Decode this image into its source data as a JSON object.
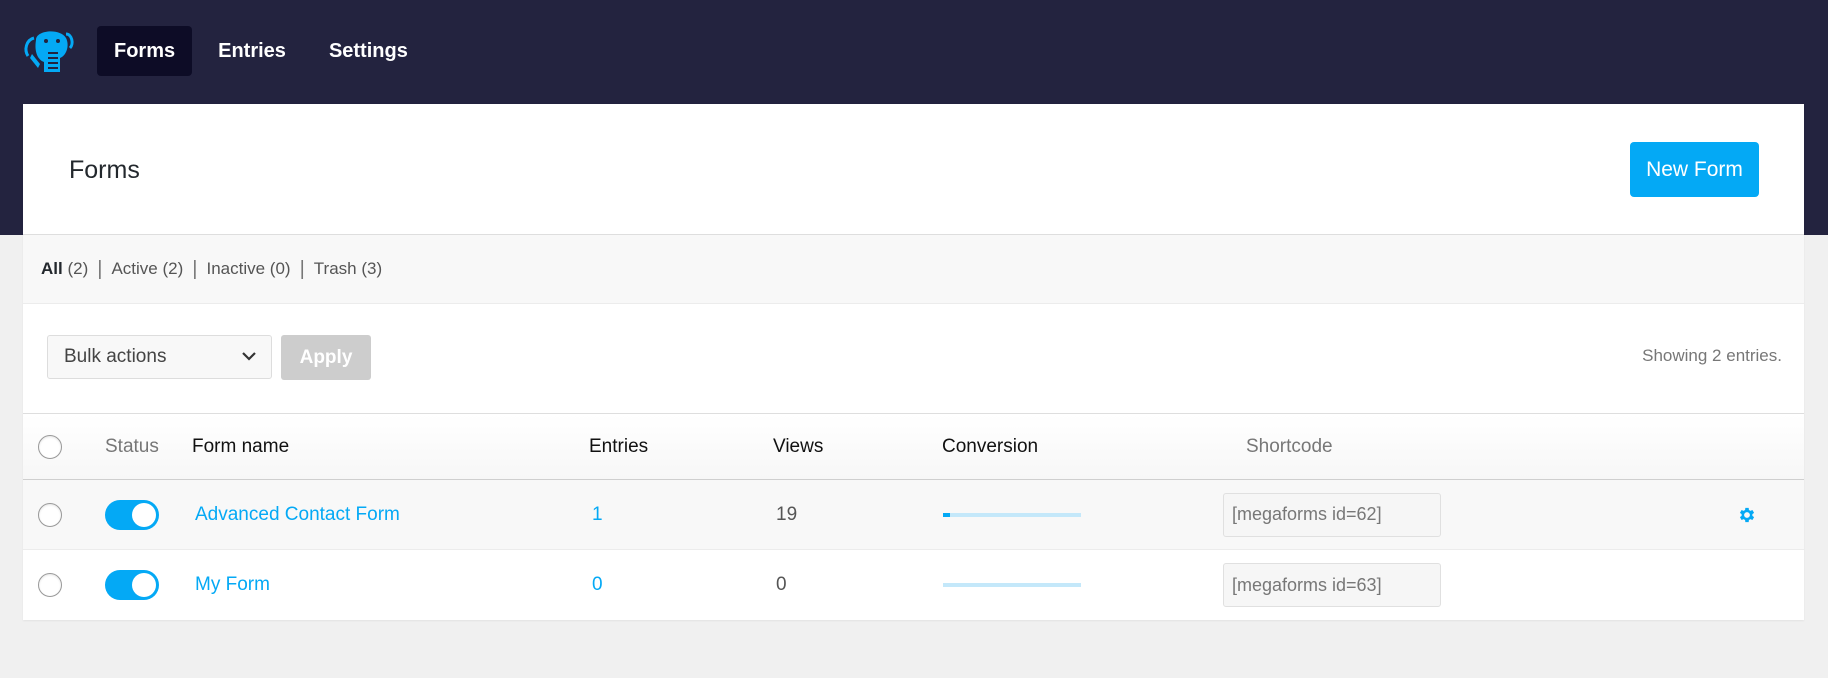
{
  "app": {
    "logo": "elephant-logo-icon",
    "nav": [
      {
        "label": "Forms",
        "active": true
      },
      {
        "label": "Entries",
        "active": false
      },
      {
        "label": "Settings",
        "active": false
      }
    ]
  },
  "page": {
    "title": "Forms",
    "new_button_label": "New Form"
  },
  "filters": [
    {
      "name": "All",
      "count": "(2)",
      "current": true
    },
    {
      "name": "Active",
      "count": "(2)",
      "current": false
    },
    {
      "name": "Inactive",
      "count": "(0)",
      "current": false
    },
    {
      "name": "Trash",
      "count": "(3)",
      "current": false
    }
  ],
  "filter_separator": "|",
  "toolbar": {
    "bulk_actions_selected": "Bulk actions",
    "apply_label": "Apply",
    "showing_text": "Showing 2 entries."
  },
  "table": {
    "columns": {
      "status": "Status",
      "form_name": "Form name",
      "entries": "Entries",
      "views": "Views",
      "conversion": "Conversion",
      "shortcode": "Shortcode"
    },
    "rows": [
      {
        "active": true,
        "form_name": "Advanced Contact Form",
        "entries": "1",
        "views": "19",
        "conversion_percent": 5.26,
        "shortcode": "[megaforms id=62]",
        "settings_icon": "gear-icon"
      },
      {
        "active": true,
        "form_name": "My Form",
        "entries": "0",
        "views": "0",
        "conversion_percent": 0,
        "shortcode": "[megaforms id=63]",
        "settings_icon": null
      }
    ]
  },
  "colors": {
    "topbar": "#23233f",
    "nav_active": "#0d0c26",
    "accent": "#04a9f5",
    "conversion_track": "#c4e8fa",
    "apply_disabled": "#cdcdcd"
  }
}
